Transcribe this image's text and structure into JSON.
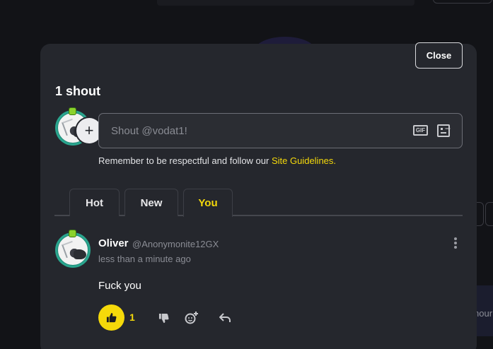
{
  "modal": {
    "close_label": "Close",
    "title": "1 shout"
  },
  "compose": {
    "placeholder": "Shout @vodat1!",
    "gif_label": "GIF",
    "guidelines_text": "Remember to be respectful and follow our ",
    "guidelines_link": "Site Guidelines."
  },
  "tabs": [
    {
      "label": "Hot",
      "active": false
    },
    {
      "label": "New",
      "active": false
    },
    {
      "label": "You",
      "active": true
    }
  ],
  "shout": {
    "name": "Oliver",
    "handle": "@Anonymonite12GX",
    "time": "less than a minute ago",
    "text": "Fuck you",
    "like_count": "1"
  },
  "background": {
    "partial_text": "hour"
  },
  "colors": {
    "accent": "#f5d90a",
    "modal_bg": "#25272d",
    "page_bg": "#121317",
    "avatar_ring": "#2aa58e"
  }
}
